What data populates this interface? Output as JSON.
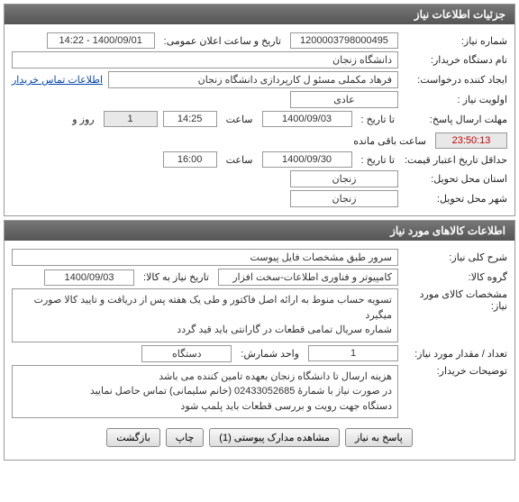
{
  "headers": {
    "detail": "جزئیات اطلاعات نیاز",
    "goods": "اطلاعات کالاهای مورد نیاز"
  },
  "detail": {
    "req_no_label": "شماره نیاز:",
    "req_no": "1200003798000495",
    "ann_date_label": "تاریخ و ساعت اعلان عمومی:",
    "ann_date": "1400/09/01 - 14:22",
    "buyer_org_label": "نام دستگاه خریدار:",
    "buyer_org": "دانشگاه زنجان",
    "creator_label": "ایجاد کننده درخواست:",
    "creator": "فرهاد مکملی مسئو ل کارپردازی دانشگاه زنجان",
    "contact_link": "اطلاعات تماس خریدار",
    "priority_label": "اولویت نیاز :",
    "priority": "عادی",
    "reply_deadline_label": "مهلت ارسال پاسخ:",
    "until_label": "تا تاریخ :",
    "reply_date": "1400/09/03",
    "time_label": "ساعت",
    "reply_time": "14:25",
    "days": "1",
    "days_label": "روز و",
    "countdown": "23:50:13",
    "remain_label": "ساعت باقی مانده",
    "credit_label": "حداقل تاریخ اعتبار قیمت:",
    "credit_date": "1400/09/30",
    "credit_time": "16:00",
    "province_label": "استان محل تحویل:",
    "province": "زنجان",
    "city_label": "شهر محل تحویل:",
    "city": "زنجان"
  },
  "goods": {
    "desc_label": "شرح کلی نیاز:",
    "desc": "سرور طبق مشخصات فایل پیوست",
    "group_label": "گروه کالا:",
    "group": "کامپیوتر و فناوری اطلاعات-سخت افزار",
    "need_date_label": "تاریخ نیاز به کالا:",
    "need_date": "1400/09/03",
    "spec_label": "مشخصات کالای مورد نیاز:",
    "spec": "تسویه حساب منوط به ارائه اصل فاکتور و طی یک هفته پس از دریافت و تایید کالا صورت میگیرد\nشماره سریال تمامی قطعات در گارانتی باید قید گردد",
    "qty_label": "تعداد / مقدار مورد نیاز:",
    "qty": "1",
    "unit_label": "واحد شمارش:",
    "unit": "دستگاه",
    "buyer_notes_label": "توضیحات خریدار:",
    "buyer_notes": "هزینه ارسال تا دانشگاه زنجان بعهده تامین کننده می باشد\nدر صورت نیاز با شمارۀ 02433052685 (خانم سلیمانی) تماس حاصل نمایید\nدستگاه جهت رویت و بررسی قطعات باید پلمپ شود"
  },
  "buttons": {
    "reply": "پاسخ به نیاز",
    "attachments": "مشاهده مدارک پیوستی (1)",
    "print": "چاپ",
    "back": "بازگشت"
  }
}
